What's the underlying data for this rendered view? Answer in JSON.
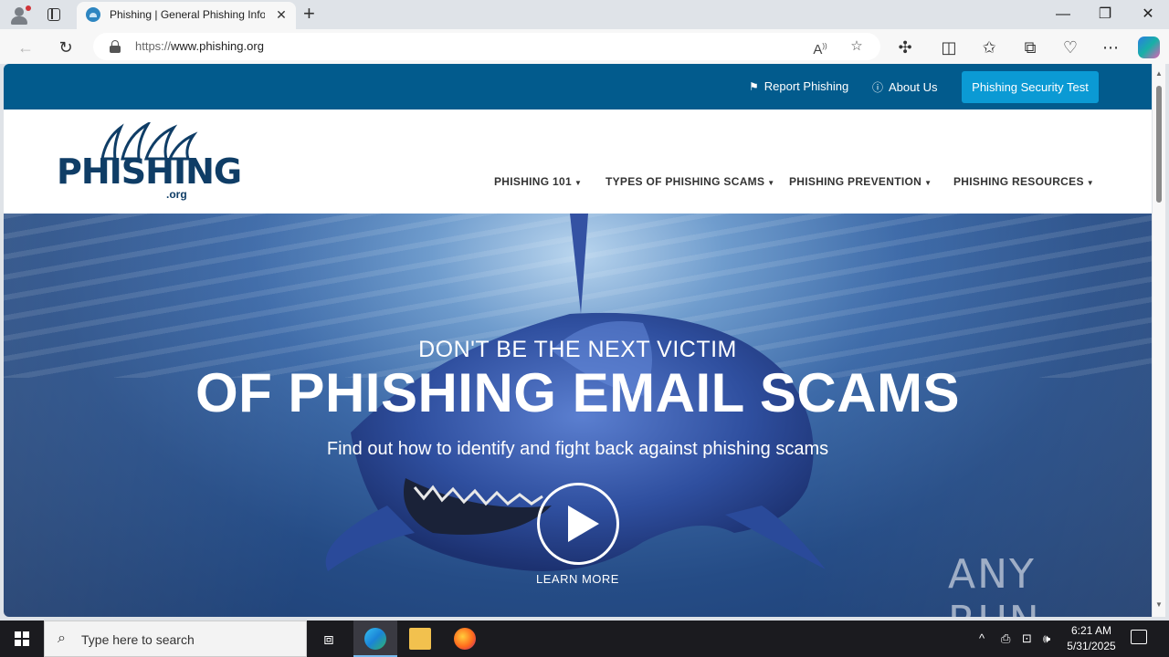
{
  "browser": {
    "tab_title": "Phishing | General Phishing Information",
    "tab_close": "✕",
    "new_tab": "+",
    "url_scheme": "https://",
    "url_host": "www.phishing.org",
    "window": {
      "minimize": "—",
      "restore": "❐",
      "close": "✕"
    }
  },
  "site": {
    "top_links": [
      {
        "label": "Report Phishing",
        "icon": "flag-icon"
      },
      {
        "label": "About Us",
        "icon": "info-icon"
      }
    ],
    "cta_label": "Phishing Security Test",
    "logo_text": "PHISHING",
    "logo_suffix": ".org",
    "menu": [
      "PHISHING 101",
      "TYPES OF PHISHING SCAMS",
      "PHISHING PREVENTION",
      "PHISHING RESOURCES"
    ],
    "hero": {
      "subtitle": "DON'T BE THE NEXT VICTIM",
      "title": "OF PHISHING EMAIL SCAMS",
      "description": "Find out how to identify and fight back against phishing scams",
      "learn_more": "LEARN MORE"
    },
    "watermark": "ANY RUN"
  },
  "taskbar": {
    "search_placeholder": "Type here to search",
    "time": "6:21 AM",
    "date": "5/31/2025"
  },
  "colors": {
    "topbar": "#025b8d",
    "cta": "#0b9ad4",
    "logo": "#0f3d66"
  }
}
